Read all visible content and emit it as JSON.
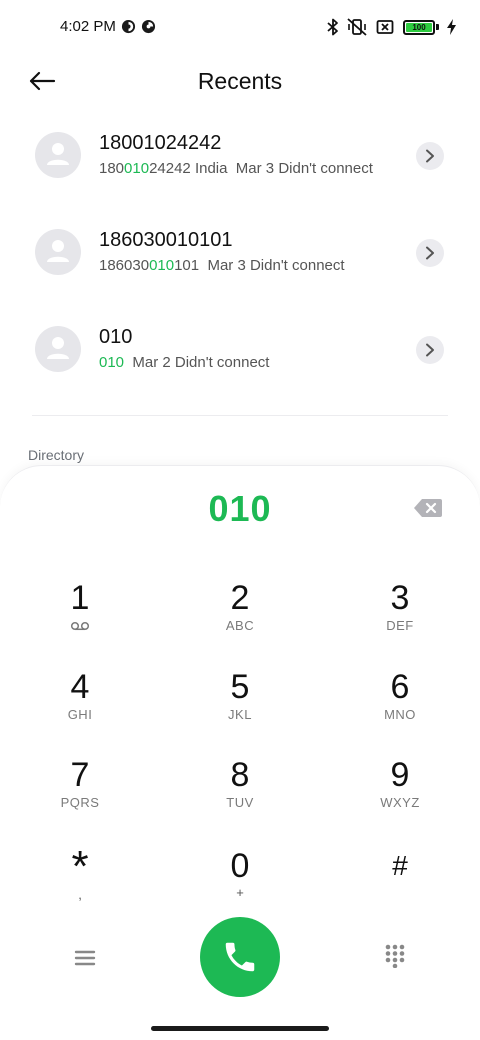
{
  "status_bar": {
    "time": "4:02 PM",
    "icons": [
      "status-app-icon",
      "status-app-icon",
      "bluetooth-icon",
      "vibrate-off-icon",
      "no-sim-icon",
      "battery-icon",
      "charging-bolt-icon"
    ],
    "battery_level": "100",
    "battery_fraction": 1.0
  },
  "header": {
    "title": "Recents",
    "back_icon": "arrow-left-icon"
  },
  "calls": [
    {
      "name": "18001024242",
      "number_parts": [
        "180",
        "010",
        "24242"
      ],
      "detail": " India  Mar 3 Didn't connect"
    },
    {
      "name": "186030010101",
      "number_parts": [
        "186030",
        "010",
        "101"
      ],
      "detail": "  Mar 3 Didn't connect"
    },
    {
      "name": "010",
      "number_parts": [
        "",
        "010",
        ""
      ],
      "detail": "  Mar 2 Didn't connect"
    }
  ],
  "section_label": "Directory",
  "dialpad": {
    "dialed": "010",
    "keys": [
      {
        "digit": "1",
        "letters": ""
      },
      {
        "digit": "2",
        "letters": "ABC"
      },
      {
        "digit": "3",
        "letters": "DEF"
      },
      {
        "digit": "4",
        "letters": "GHI"
      },
      {
        "digit": "5",
        "letters": "JKL"
      },
      {
        "digit": "6",
        "letters": "MNO"
      },
      {
        "digit": "7",
        "letters": "PQRS"
      },
      {
        "digit": "8",
        "letters": "TUV"
      },
      {
        "digit": "9",
        "letters": "WXYZ"
      },
      {
        "digit": "*",
        "letters": ","
      },
      {
        "digit": "0",
        "letters": "+"
      },
      {
        "digit": "#",
        "letters": ""
      }
    ],
    "icons": {
      "key_one": "voicemail-icon",
      "delete": "backspace-icon",
      "menu": "menu-icon",
      "call": "phone-icon",
      "keypad": "dialpad-icon"
    }
  },
  "colors": {
    "accent": "#1db954",
    "avatar_bg": "#e6e6ea",
    "secondary_text": "#555555"
  }
}
